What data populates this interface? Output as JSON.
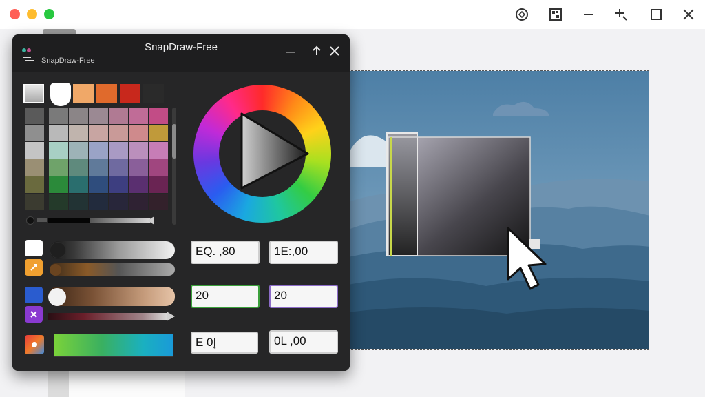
{
  "window": {
    "controls": [
      "extension-icon",
      "qr-icon",
      "minimize-icon",
      "pin-icon",
      "maximize-icon",
      "close-icon"
    ]
  },
  "dialog": {
    "title": "SnapDraw-Free",
    "subtitle": "SnapDraw-Free",
    "controls": [
      "minimize-icon",
      "expand-icon",
      "close-icon"
    ]
  },
  "swatches": [
    "#d8d8d8",
    "#ffffff",
    "#f0a868",
    "#e06a2c",
    "#c8281c",
    "#2a2a2a"
  ],
  "fields": {
    "value_1": "EQ. ,80",
    "value_2": "1E:,00",
    "value_3": "20",
    "value_4": "20",
    "value_5": "E    0Į",
    "value_6": "0L ,00"
  },
  "colors": {
    "dialog_bg": "#1e1e1f",
    "field_green_border": "#3ba03b",
    "field_purple_border": "#8c6cc8"
  }
}
